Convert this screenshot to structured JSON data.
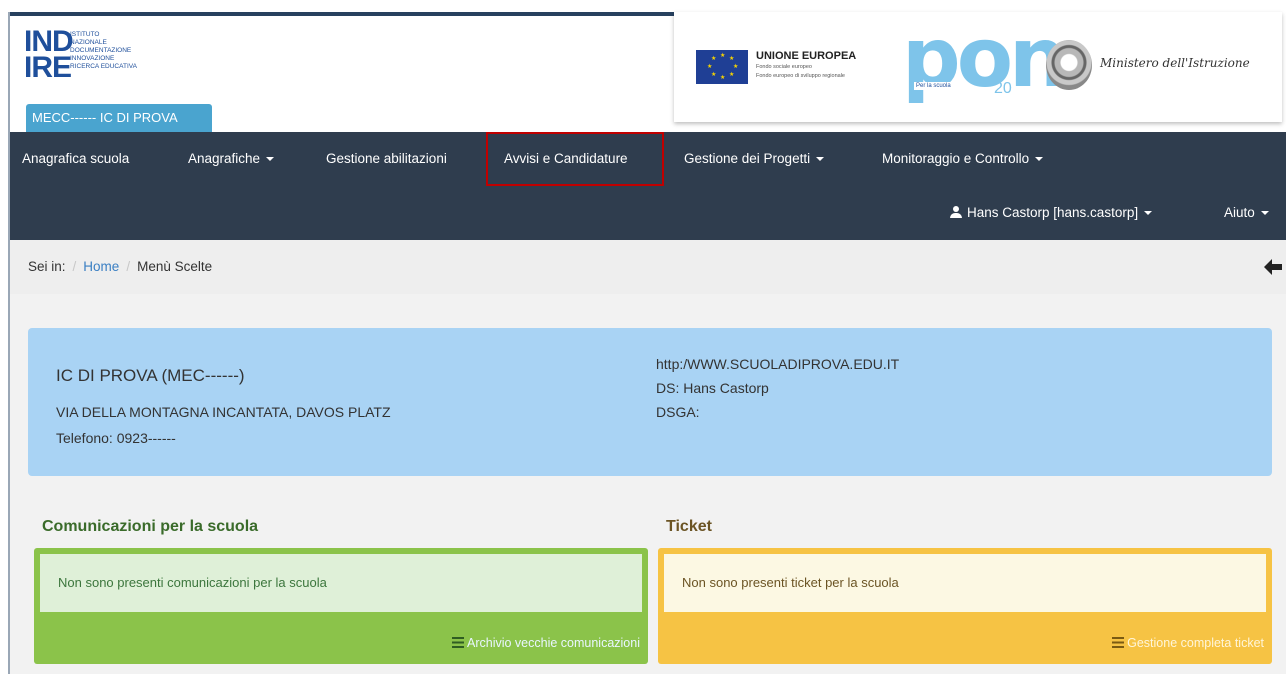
{
  "logo": {
    "line1": "IND",
    "line2": "IRE",
    "small_lines": [
      "Istituto",
      "Nazionale",
      "Documentazione",
      "Innovazione",
      "Ricerca Educativa"
    ]
  },
  "school_tab": "MECC------ IC DI PROVA",
  "pon": {
    "eu_title": "UNIONE EUROPEA",
    "eu_sub1": "Fondo sociale europeo",
    "eu_sub2": "Fondo europeo di sviluppo regionale",
    "pon_letters": "pon",
    "pon_tag": "Per la scuola",
    "pon_years": "20",
    "ministry": "Ministero dell'Istruzione"
  },
  "nav": {
    "items": [
      {
        "label": "Anagrafica scuola",
        "dropdown": false
      },
      {
        "label": "Anagrafiche",
        "dropdown": true
      },
      {
        "label": "Gestione abilitazioni",
        "dropdown": false
      },
      {
        "label": "Avvisi e Candidature",
        "dropdown": false,
        "highlighted": true
      },
      {
        "label": "Gestione dei Progetti",
        "dropdown": true
      },
      {
        "label": "Monitoraggio e Controllo",
        "dropdown": true
      }
    ],
    "user_label": "Hans Castorp [hans.castorp]",
    "help_label": "Aiuto",
    "highlight_color": "#c00000"
  },
  "breadcrumb": {
    "prefix": "Sei in:",
    "home": "Home",
    "current": "Menù Scelte"
  },
  "school": {
    "name": "IC DI PROVA (MEC------)",
    "address": "VIA DELLA MONTAGNA INCANTATA, DAVOS PLATZ",
    "phone": "Telefono: 0923------",
    "url": "http:/WWW.SCUOLADIPROVA.EDU.IT",
    "ds": "DS: Hans Castorp",
    "dsga": "DSGA:"
  },
  "communications": {
    "title": "Comunicazioni per la scuola",
    "message": "Non sono presenti comunicazioni per la scuola",
    "link": "Archivio vecchie comunicazioni",
    "color": "#8bc34a"
  },
  "tickets": {
    "title": "Ticket",
    "message": "Non sono presenti ticket per la scuola",
    "link": "Gestione completa ticket",
    "color": "#f6c344"
  },
  "icons": {
    "user": "user-icon",
    "back": "arrow-left-icon",
    "list": "list-icon"
  }
}
